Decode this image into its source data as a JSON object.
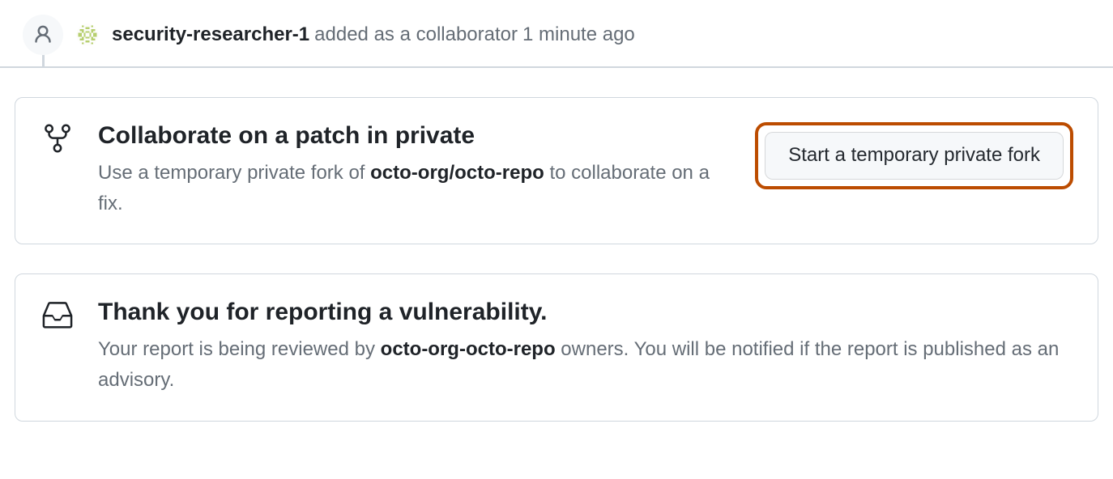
{
  "timeline": {
    "actor": "security-researcher-1",
    "action": "added as a collaborator",
    "timestamp": "1 minute ago"
  },
  "cards": {
    "collaborate": {
      "title": "Collaborate on a patch in private",
      "desc_prefix": "Use a temporary private fork of ",
      "repo": "octo-org/octo-repo",
      "desc_suffix": " to collaborate on a fix.",
      "button": "Start a temporary private fork"
    },
    "thankyou": {
      "title": "Thank you for reporting a vulnerability.",
      "desc_prefix": "Your report is being reviewed by ",
      "repo": "octo-org-octo-repo",
      "desc_suffix": " owners. You will be notified if the report is published as an advisory."
    }
  }
}
